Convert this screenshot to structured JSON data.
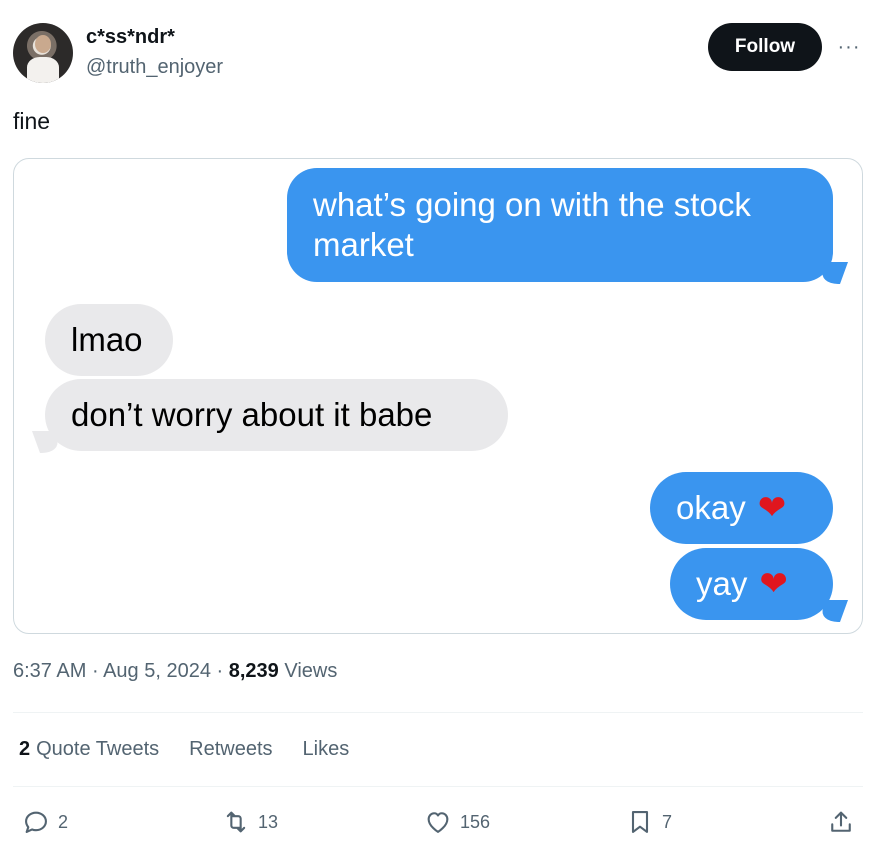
{
  "author": {
    "display_name": "c*ss*ndr*",
    "handle": "@truth_enjoyer",
    "follow_label": "Follow",
    "more_label": "···"
  },
  "tweet": {
    "text": "fine"
  },
  "messages": [
    {
      "from": "me",
      "lines": [
        "what’s going on with the stock",
        "market"
      ]
    },
    {
      "from": "them",
      "text": "lmao"
    },
    {
      "from": "them",
      "text": "don’t worry about it babe"
    },
    {
      "from": "me",
      "text": "okay",
      "emoji": "❤"
    },
    {
      "from": "me",
      "text": "yay",
      "emoji": "❤"
    }
  ],
  "meta": {
    "time": "6:37 AM",
    "sep": "·",
    "date": "Aug 5, 2024",
    "views_count": "8,239",
    "views_label": "Views"
  },
  "stats": {
    "quote_count": "2",
    "quote_label": "Quote Tweets",
    "retweets_label": "Retweets",
    "likes_label": "Likes"
  },
  "actions": {
    "reply": "2",
    "retweet": "13",
    "like": "156",
    "bookmark": "7"
  },
  "colors": {
    "sent_bubble": "#3a95ef",
    "received_bubble": "#e9e9eb",
    "follow_bg": "#0f1419",
    "muted_text": "#536471"
  }
}
